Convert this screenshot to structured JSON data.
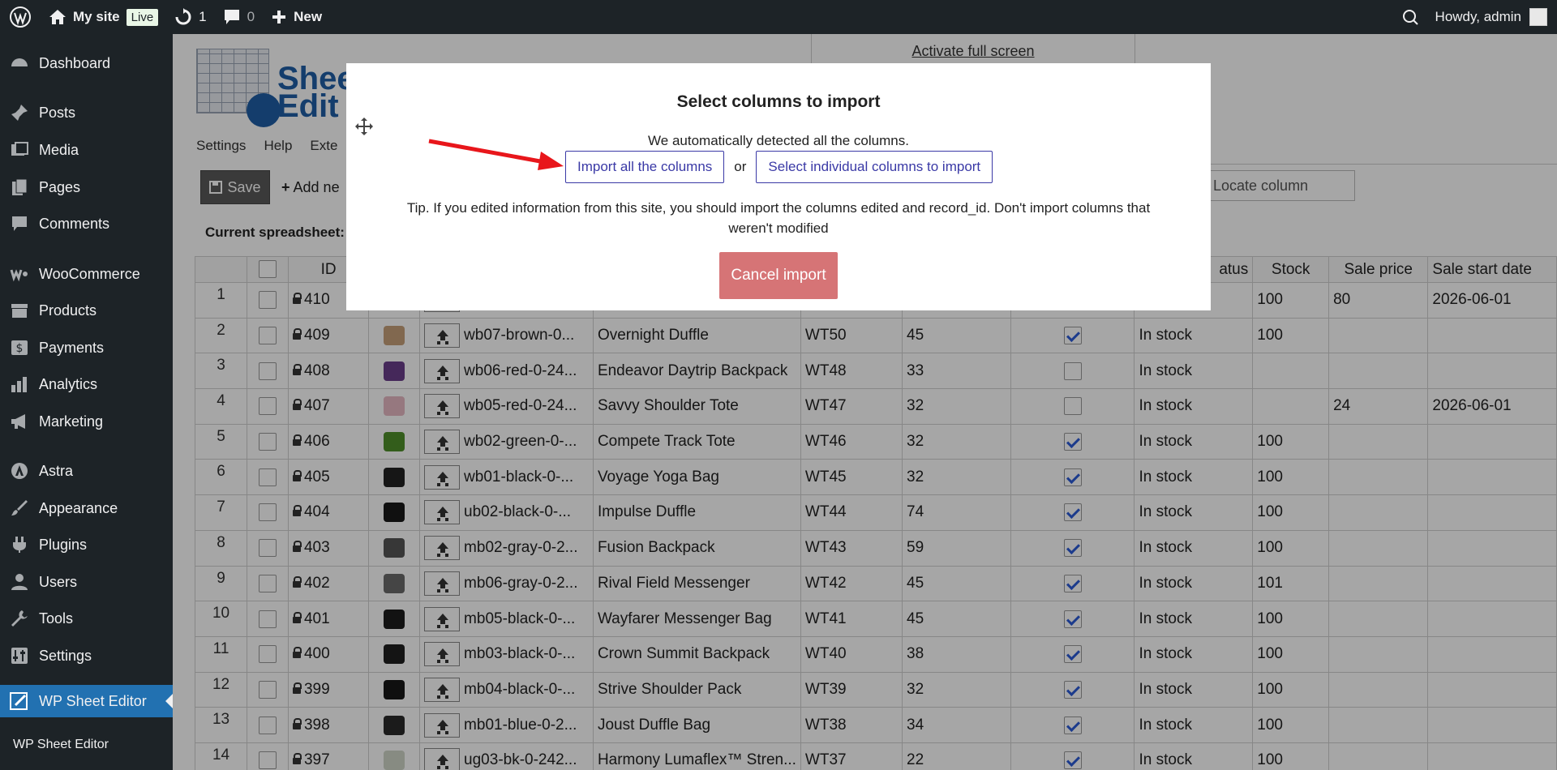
{
  "admin_bar": {
    "site_name": "My site",
    "live_badge": "Live",
    "updates_count": "1",
    "comments_count": "0",
    "new_label": "New",
    "howdy": "Howdy, admin"
  },
  "sidebar": {
    "items": [
      {
        "label": "Dashboard",
        "icon": "dashboard-icon"
      },
      {
        "label": "Posts",
        "icon": "pin-icon"
      },
      {
        "label": "Media",
        "icon": "media-icon"
      },
      {
        "label": "Pages",
        "icon": "pages-icon"
      },
      {
        "label": "Comments",
        "icon": "comment-icon"
      },
      {
        "label": "WooCommerce",
        "icon": "woocommerce-icon"
      },
      {
        "label": "Products",
        "icon": "archive-icon"
      },
      {
        "label": "Payments",
        "icon": "dollar-icon"
      },
      {
        "label": "Analytics",
        "icon": "bar-chart-icon"
      },
      {
        "label": "Marketing",
        "icon": "megaphone-icon"
      },
      {
        "label": "Astra",
        "icon": "astra-icon"
      },
      {
        "label": "Appearance",
        "icon": "brush-icon"
      },
      {
        "label": "Plugins",
        "icon": "plug-icon"
      },
      {
        "label": "Users",
        "icon": "user-icon"
      },
      {
        "label": "Tools",
        "icon": "wrench-icon"
      },
      {
        "label": "Settings",
        "icon": "sliders-icon"
      },
      {
        "label": "WP Sheet Editor",
        "icon": "sheet-editor-icon"
      }
    ],
    "submenu_label": "WP Sheet Editor"
  },
  "editor": {
    "fullscreen_link": "Activate full screen",
    "logo_text_1": "Sheet",
    "logo_text_2": "Edit",
    "logo_reg": "®",
    "tabs": [
      "Settings",
      "Help",
      "Exte"
    ],
    "save_label": "Save",
    "add_new_label": "Add ne",
    "locate_placeholder": "Locate column",
    "current_spreadsheet": "Current spreadsheet:"
  },
  "table": {
    "headers": [
      "",
      "",
      "ID",
      "",
      "",
      "",
      "",
      "",
      "",
      "",
      "atus",
      "Stock",
      "Sale price",
      "Sale start date"
    ],
    "rows": [
      {
        "n": "1",
        "id": "410",
        "thumb": "#ffffff",
        "slug": "",
        "name": "",
        "sku": "",
        "price": "",
        "checked": null,
        "status": "",
        "stock": "100",
        "sale": "80",
        "start": "2026-06-01"
      },
      {
        "n": "2",
        "id": "409",
        "thumb": "#c6a07a",
        "slug": "wb07-brown-0...",
        "name": "Overnight Duffle",
        "sku": "WT50",
        "price": "45",
        "checked": true,
        "status": "In stock",
        "stock": "100",
        "sale": "",
        "start": ""
      },
      {
        "n": "3",
        "id": "408",
        "thumb": "#6b3e8a",
        "slug": "wb06-red-0-24...",
        "name": "Endeavor Daytrip Backpack",
        "sku": "WT48",
        "price": "33",
        "checked": false,
        "status": "In stock",
        "stock": "",
        "sale": "",
        "start": ""
      },
      {
        "n": "4",
        "id": "407",
        "thumb": "#e6b8c4",
        "slug": "wb05-red-0-24...",
        "name": "Savvy Shoulder Tote",
        "sku": "WT47",
        "price": "32",
        "checked": false,
        "status": "In stock",
        "stock": "",
        "sale": "24",
        "start": "2026-06-01"
      },
      {
        "n": "5",
        "id": "406",
        "thumb": "#4f8f2a",
        "slug": "wb02-green-0-...",
        "name": "Compete Track Tote",
        "sku": "WT46",
        "price": "32",
        "checked": true,
        "status": "In stock",
        "stock": "100",
        "sale": "",
        "start": ""
      },
      {
        "n": "6",
        "id": "405",
        "thumb": "#222222",
        "slug": "wb01-black-0-...",
        "name": "Voyage Yoga Bag",
        "sku": "WT45",
        "price": "32",
        "checked": true,
        "status": "In stock",
        "stock": "100",
        "sale": "",
        "start": ""
      },
      {
        "n": "7",
        "id": "404",
        "thumb": "#1a1a1a",
        "slug": "ub02-black-0-...",
        "name": "Impulse Duffle",
        "sku": "WT44",
        "price": "74",
        "checked": true,
        "status": "In stock",
        "stock": "100",
        "sale": "",
        "start": ""
      },
      {
        "n": "8",
        "id": "403",
        "thumb": "#555555",
        "slug": "mb02-gray-0-2...",
        "name": "Fusion Backpack",
        "sku": "WT43",
        "price": "59",
        "checked": true,
        "status": "In stock",
        "stock": "100",
        "sale": "",
        "start": ""
      },
      {
        "n": "9",
        "id": "402",
        "thumb": "#6a6a6a",
        "slug": "mb06-gray-0-2...",
        "name": "Rival Field Messenger",
        "sku": "WT42",
        "price": "45",
        "checked": true,
        "status": "In stock",
        "stock": "101",
        "sale": "",
        "start": ""
      },
      {
        "n": "10",
        "id": "401",
        "thumb": "#1c1c1c",
        "slug": "mb05-black-0-...",
        "name": "Wayfarer Messenger Bag",
        "sku": "WT41",
        "price": "45",
        "checked": true,
        "status": "In stock",
        "stock": "100",
        "sale": "",
        "start": ""
      },
      {
        "n": "11",
        "id": "400",
        "thumb": "#202020",
        "slug": "mb03-black-0-...",
        "name": "Crown Summit Backpack",
        "sku": "WT40",
        "price": "38",
        "checked": true,
        "status": "In stock",
        "stock": "100",
        "sale": "",
        "start": ""
      },
      {
        "n": "12",
        "id": "399",
        "thumb": "#181818",
        "slug": "mb04-black-0-...",
        "name": "Strive Shoulder Pack",
        "sku": "WT39",
        "price": "32",
        "checked": true,
        "status": "In stock",
        "stock": "100",
        "sale": "",
        "start": ""
      },
      {
        "n": "13",
        "id": "398",
        "thumb": "#2a2a2a",
        "slug": "mb01-blue-0-2...",
        "name": "Joust Duffle Bag",
        "sku": "WT38",
        "price": "34",
        "checked": true,
        "status": "In stock",
        "stock": "100",
        "sale": "",
        "start": ""
      },
      {
        "n": "14",
        "id": "397",
        "thumb": "#cfd6c8",
        "slug": "ug03-bk-0-242...",
        "name": "Harmony Lumaflex™ Stren...",
        "sku": "WT37",
        "price": "22",
        "checked": true,
        "status": "In stock",
        "stock": "100",
        "sale": "",
        "start": ""
      }
    ]
  },
  "modal": {
    "title": "Select columns to import",
    "description": "We automatically detected all the columns.",
    "import_all_label": "Import all the columns",
    "or_label": "or",
    "select_individual_label": "Select individual columns to import",
    "tip": "Tip. If you edited information from this site, you should import the columns edited and record_id. Don't import columns that weren't modified",
    "cancel_label": "Cancel import",
    "colors": {
      "accent": "#3a39a6",
      "cancel": "#d67476",
      "arrow": "#e8161b"
    }
  }
}
